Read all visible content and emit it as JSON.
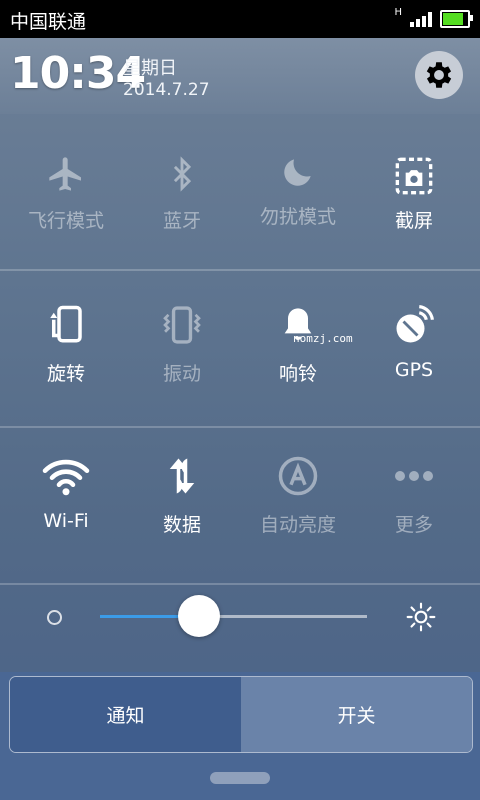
{
  "status_bar": {
    "carrier": "中国联通",
    "network_badge": "H",
    "battery_level": 0.9
  },
  "header": {
    "time": "10:34",
    "weekday": "星期日",
    "date": "2014.7.27",
    "settings_icon": "gear-icon"
  },
  "toggles": [
    {
      "label": "飞行模式",
      "icon": "airplane-icon",
      "state": "off"
    },
    {
      "label": "蓝牙",
      "icon": "bluetooth-icon",
      "state": "off"
    },
    {
      "label": "勿扰模式",
      "icon": "moon-icon",
      "state": "off"
    },
    {
      "label": "截屏",
      "icon": "screenshot-icon",
      "state": "on"
    },
    {
      "label": "旋转",
      "icon": "rotate-icon",
      "state": "on"
    },
    {
      "label": "振动",
      "icon": "vibrate-icon",
      "state": "off"
    },
    {
      "label": "响铃",
      "icon": "bell-icon",
      "state": "on"
    },
    {
      "label": "GPS",
      "icon": "gps-icon",
      "state": "on"
    },
    {
      "label": "Wi-Fi",
      "icon": "wifi-icon",
      "state": "on"
    },
    {
      "label": "数据",
      "icon": "data-icon",
      "state": "on"
    },
    {
      "label": "自动亮度",
      "icon": "auto-brightness-icon",
      "state": "off"
    },
    {
      "label": "更多",
      "icon": "more-icon",
      "state": "off"
    }
  ],
  "watermark": "nomzj.com",
  "brightness": {
    "level": 0.37,
    "min_icon": "brightness-low-icon",
    "max_icon": "brightness-high-icon"
  },
  "tabs": {
    "left": "通知",
    "right": "开关"
  },
  "colors": {
    "accent": "#3b9be8",
    "tab_active": "#3f5d8d",
    "tab_inactive": "#6a83a9"
  }
}
